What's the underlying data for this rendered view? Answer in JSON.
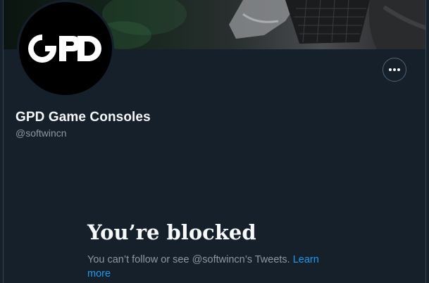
{
  "profile": {
    "display_name": "GPD Game Consoles",
    "handle": "@softwincn",
    "avatar_logo_text": "GPD"
  },
  "actions": {
    "more_icon": "more-horizontal-icon"
  },
  "blocked": {
    "title": "You’re blocked",
    "description": "You can’t follow or see @softwincn’s Tweets. ",
    "learn_more": "Learn more"
  },
  "colors": {
    "background": "#15202b",
    "primary_text": "#f7f9f9",
    "secondary_text": "#8b98a5",
    "link": "#1d9bf0",
    "border": "#38444d"
  }
}
